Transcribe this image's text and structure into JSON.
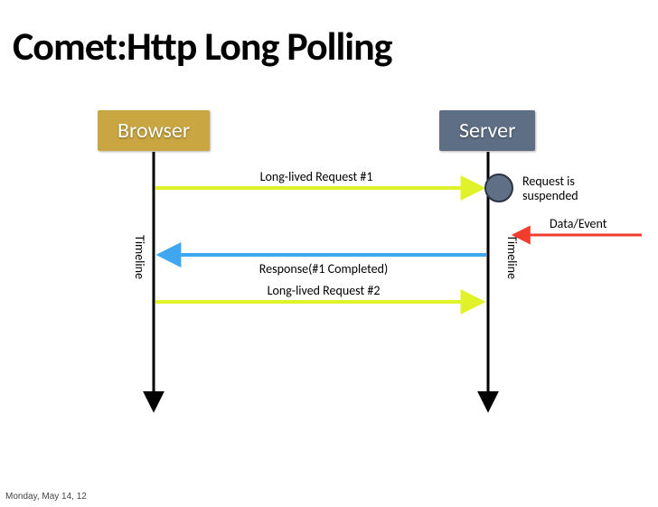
{
  "title": "Comet:Http Long Polling",
  "browser_label": "Browser",
  "server_label": "Server",
  "timeline_label": "Timeline",
  "messages": {
    "req1": "Long-lived Request #1",
    "suspended": "Request is\nsuspended",
    "data_event": "Data/Event",
    "resp1": "Response(#1 Completed)",
    "req2": "Long-lived Request #2"
  },
  "footer_date": "Monday, May 14, 12",
  "colors": {
    "browser_box": "#c9a641",
    "server_box": "#5e6e85",
    "request_arrow": "#dff22a",
    "response_arrow": "#3fa7f0",
    "event_arrow": "#f23d2e",
    "node_fill": "#5f6f86"
  }
}
